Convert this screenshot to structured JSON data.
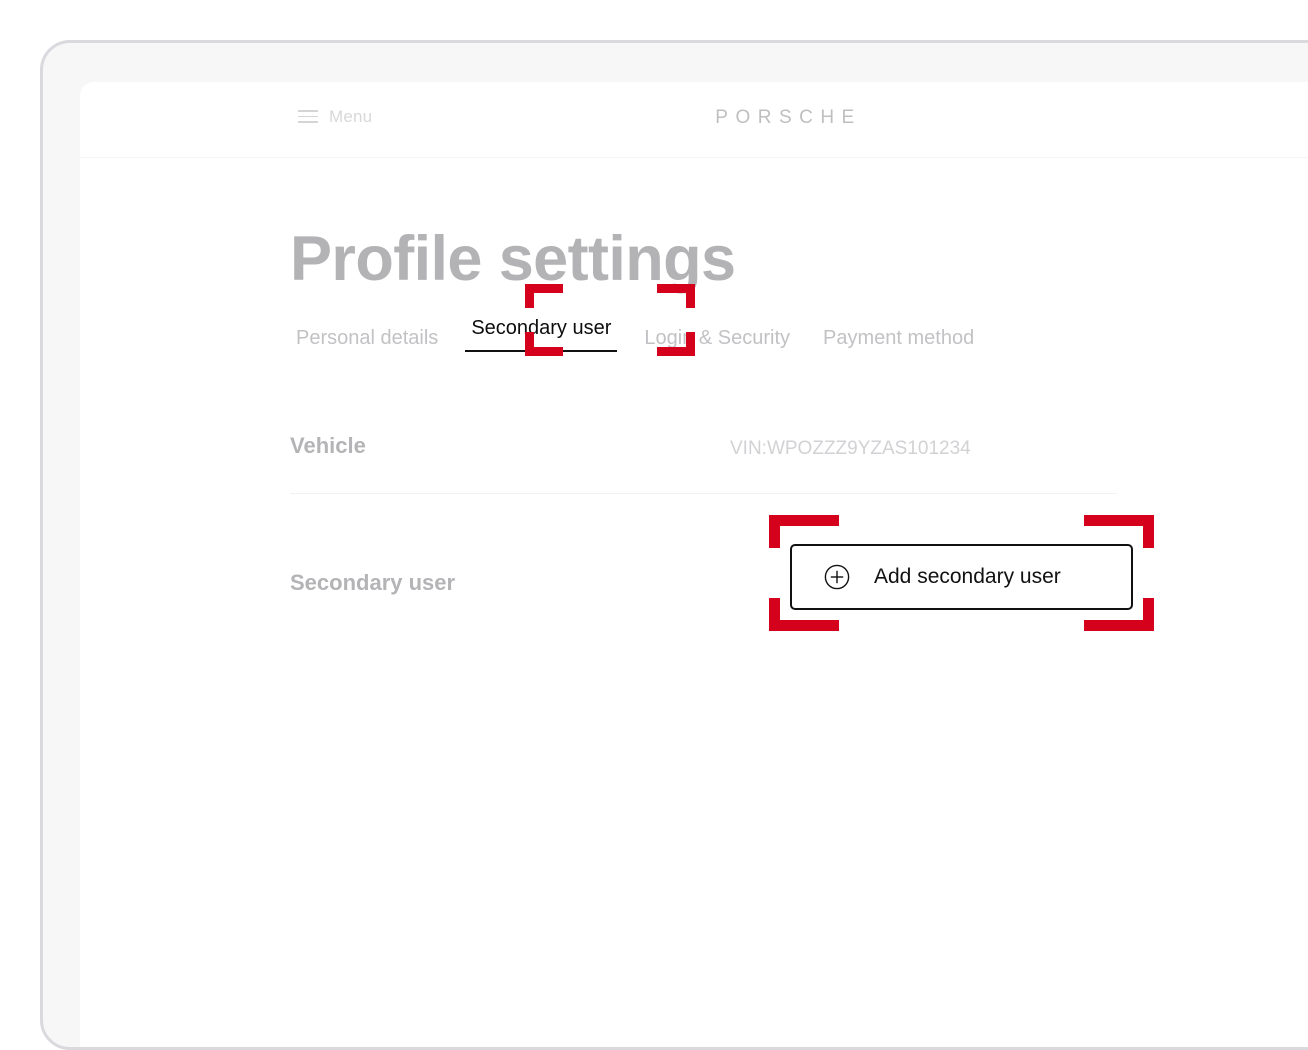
{
  "header": {
    "menu_label": "Menu",
    "menu_icon": "hamburger-icon",
    "brand": "PORSCHE"
  },
  "page": {
    "title": "Profile settings"
  },
  "tabs": [
    {
      "label": "Personal details",
      "active": false
    },
    {
      "label": "Secondary user",
      "active": true
    },
    {
      "label": "Login & Security",
      "active": false
    },
    {
      "label": "Payment method",
      "active": false
    }
  ],
  "rows": {
    "vehicle": {
      "label": "Vehicle",
      "value": "VIN:WPOZZZ9YZAS101234"
    },
    "secondary_user": {
      "label": "Secondary user",
      "button_label": "Add secondary user",
      "button_icon": "plus-circle-icon"
    }
  },
  "colors": {
    "highlight_red": "#D5001C",
    "active_text": "#0D0D0D",
    "muted_text": "#BFBFC2"
  }
}
